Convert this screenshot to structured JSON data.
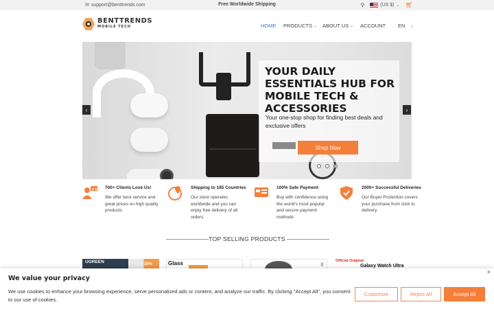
{
  "topbar": {
    "email": "support@benttrends.com",
    "shipping": "Free Worldwide Shipping",
    "currency": "(US $)"
  },
  "header": {
    "logo_text": "BENTTRENDS",
    "logo_sub": "MOBILE TECH",
    "nav": {
      "home": "HOME",
      "products": "PRODUCTS",
      "about": "ABOUT US",
      "account": "ACCOUNT",
      "lang": "EN"
    }
  },
  "hero": {
    "title": "YOUR DAILY ESSENTIALS HUB FOR MOBILE TECH & ACCESSORIES",
    "subtitle": "Your one-stop shop for finding best deals and exclusive offers",
    "button": "Shop Now",
    "prev": "‹",
    "next": "›"
  },
  "features": [
    {
      "title": "700+ Clients Love Us!",
      "text": "We offer best service and great prices on high quality products",
      "icon": "clients-icon"
    },
    {
      "title": "Shipping to 185 Countries",
      "text": "Our store operates worldwide and you can enjoy free delivery of all orders",
      "icon": "globe-location-icon"
    },
    {
      "title": "100% Safe Payment",
      "text": "Buy with confidence using the world's most popular and secure payment methods",
      "icon": "payment-card-icon"
    },
    {
      "title": "2000+ Successful Deliveries",
      "text": "Our Buyer Protection covers your purchase from click to delivery",
      "icon": "shield-check-icon"
    }
  ],
  "section": {
    "title": "TOP SELLING PRODUCTS"
  },
  "products": {
    "p1_brand": "UGREEN",
    "p1_badge": "30%",
    "p2_label": "Glass",
    "p4_label": "Official Original",
    "p4_name": "Galaxy Watch Ultra"
  },
  "cookie": {
    "title": "We value your privacy",
    "text": "We use cookies to enhance your browsing experience, serve personalized ads or content, and analyze our traffic. By clicking \"Accept All\", you consent to our use of cookies.",
    "customize": "Customize",
    "reject": "Reject All",
    "accept": "Accept All",
    "close": "×"
  },
  "colors": {
    "accent": "#f47f3b",
    "nav_active": "#2a8bbf"
  }
}
